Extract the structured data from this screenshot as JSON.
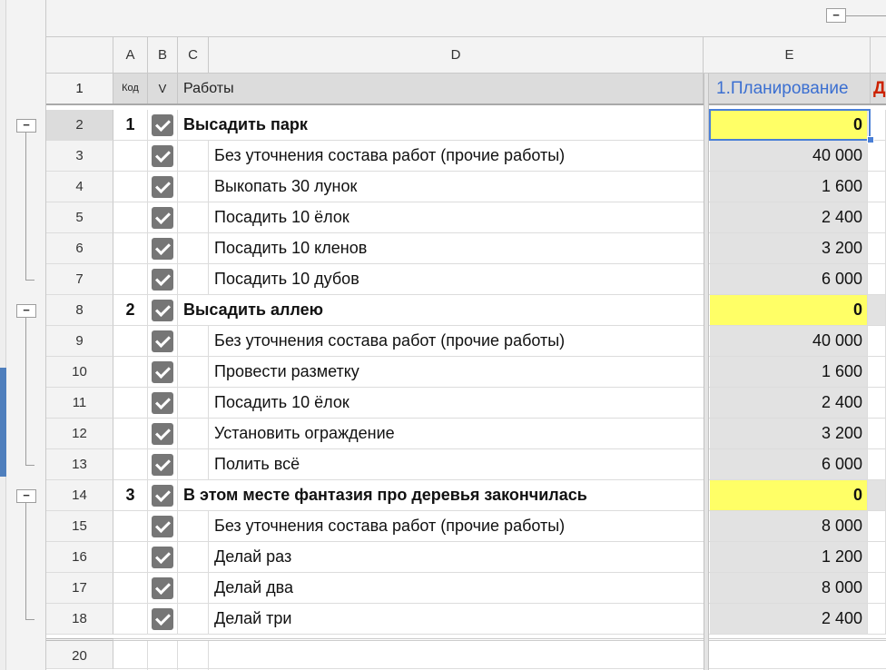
{
  "columns": {
    "a": "A",
    "b": "B",
    "c": "C",
    "d": "D",
    "e": "E"
  },
  "header_row": {
    "rownum": "1",
    "kod": "Код",
    "v": "V",
    "raboty": "Работы",
    "planning": "1.Планирование",
    "next_partial": "Д"
  },
  "colors": {
    "planning_header": "#3b6fd1",
    "next_header": "#cc2200",
    "highlight": "#ffff66",
    "checkbox": "#767676",
    "selection": "#4a7fd6"
  },
  "rows": [
    {
      "num": "2",
      "kod": "1",
      "checked": true,
      "name": "Высадить парк",
      "value": "0",
      "group": true
    },
    {
      "num": "3",
      "kod": "",
      "checked": true,
      "name": "Без уточнения состава работ (прочие работы)",
      "value": "40 000"
    },
    {
      "num": "4",
      "kod": "",
      "checked": true,
      "name": "Выкопать 30 лунок",
      "value": "1 600"
    },
    {
      "num": "5",
      "kod": "",
      "checked": true,
      "name": "Посадить 10 ёлок",
      "value": "2 400"
    },
    {
      "num": "6",
      "kod": "",
      "checked": true,
      "name": "Посадить 10 кленов",
      "value": "3 200"
    },
    {
      "num": "7",
      "kod": "",
      "checked": true,
      "name": "Посадить 10 дубов",
      "value": "6 000"
    },
    {
      "num": "8",
      "kod": "2",
      "checked": true,
      "name": "Высадить аллею",
      "value": "0",
      "group": true
    },
    {
      "num": "9",
      "kod": "",
      "checked": true,
      "name": "Без уточнения состава работ (прочие работы)",
      "value": "40 000"
    },
    {
      "num": "10",
      "kod": "",
      "checked": true,
      "name": "Провести разметку",
      "value": "1 600"
    },
    {
      "num": "11",
      "kod": "",
      "checked": true,
      "name": "Посадить 10 ёлок",
      "value": "2 400"
    },
    {
      "num": "12",
      "kod": "",
      "checked": true,
      "name": "Установить ограждение",
      "value": "3 200"
    },
    {
      "num": "13",
      "kod": "",
      "checked": true,
      "name": "Полить всё",
      "value": "6 000"
    },
    {
      "num": "14",
      "kod": "3",
      "checked": true,
      "name": "В этом месте фантазия про деревья закончилась",
      "value": "0",
      "group": true
    },
    {
      "num": "15",
      "kod": "",
      "checked": true,
      "name": "Без уточнения состава работ (прочие работы)",
      "value": "8 000"
    },
    {
      "num": "16",
      "kod": "",
      "checked": true,
      "name": "Делай раз",
      "value": "1 200"
    },
    {
      "num": "17",
      "kod": "",
      "checked": true,
      "name": "Делай два",
      "value": "8 000"
    },
    {
      "num": "18",
      "kod": "",
      "checked": true,
      "name": "Делай три",
      "value": "2 400"
    }
  ],
  "last_row_num": "20",
  "outline": {
    "collapse_symbol": "−"
  }
}
